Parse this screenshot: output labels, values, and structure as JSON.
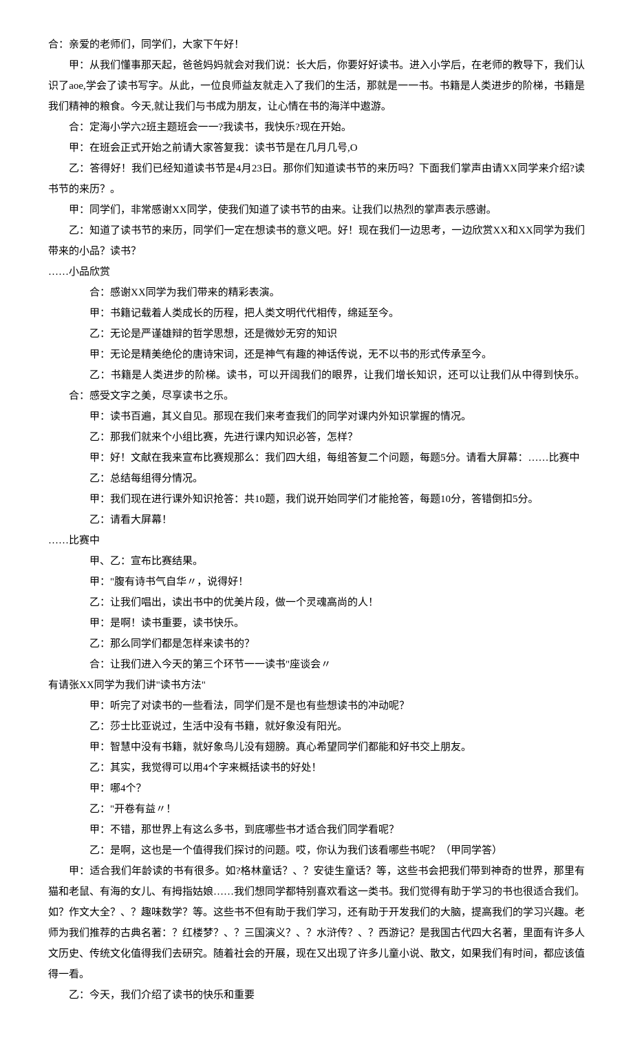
{
  "p": [
    "合：亲爱的老师们，同学们，大家下午好！",
    "甲：从我们懂事那天起，爸爸妈妈就会对我们说：长大后，你要好好读书。进入小学后，在老师的教导下，我们认识了aoe,学会了读书写字。从此，一位良师益友就走入了我们的生活，那就是一一书。书籍是人类进步的阶梯，书籍是我们精神的粮食。今天,就让我们与书成为朋友，让心情在书的海洋中遨游。",
    "合：定海小学六2班主题班会一一?我读书，我快乐?现在开始。",
    "甲：在班会正式开始之前请大家答复我：读书节是在几月几号,O",
    "乙：答得好！我们已经知道读书节是4月23日。那你们知道读书节的来历吗？下面我们掌声由请XX同学来介绍?读书节的来历？。",
    "甲：同学们，非常感谢XX同学，使我们知道了读书节的由来。让我们以热烈的掌声表示感谢。",
    "乙：知道了读书节的来历，同学们一定在想读书的意义吧。好！现在我们一边思考，一边欣赏XX和XX同学为我们带来的小品？读书？",
    "……小品欣赏",
    "合：感谢XX同学为我们带来的精彩表演。",
    "甲：书籍记载着人类成长的历程，把人类文明代代相传，绵延至今。",
    "乙：无论是严谨雄辩的哲学思想，还是微妙无穷的知识",
    "甲：无论是精美绝伦的唐诗宋词，还是神气有趣的神话传说，无不以书的形式传承至今。",
    "乙：书籍是人类进步的阶梯。读书，可以开阔我们的眼界，让我们增长知识，还可以让我们从中得到快乐。合：感受文字之美，尽享读书之乐。",
    "甲：读书百遍，其义自见。那现在我们来考查我们的同学对课内外知识掌握的情况。",
    "乙：那我们就来个小组比赛，先进行课内知识必答，怎样？",
    "甲：好！文献在我来宣布比赛规那么：我们四大组，每组答复二个问题，每题5分。请看大屏幕：……比赛中",
    "乙：总结每组得分情况。",
    "甲：我们现在进行课外知识抢答：共10题，我们说开始同学们才能抢答，每题10分，答错倒扣5分。",
    "乙：请看大屏幕！",
    "……比赛中",
    "甲、乙：宣布比赛结果。",
    "甲：\"腹有诗书气自华〃，说得好！",
    "乙：让我们唱出，读出书中的优美片段，做一个灵魂高尚的人！",
    "甲：是啊！读书重要，读书快乐。",
    "乙：那么同学们都是怎样来读书的？",
    "合：让我们进入今天的第三个环节一一读书\"座谈会〃",
    "有请张XX同学为我们讲\"读书方法\"",
    "甲：听完了对读书的一些看法，同学们是不是也有些想读书的冲动呢？",
    "乙：莎士比亚说过，生活中没有书籍，就好象没有阳光。",
    "甲：智慧中没有书籍，就好象鸟儿没有翅膀。真心希望同学们都能和好书交上朋友。",
    "乙：其实，我觉得可以用4个字来概括读书的好处！",
    "甲：哪4个？",
    "乙：\"开卷有益〃！",
    "甲：不错，那世界上有这么多书，到底哪些书才适合我们同学看呢？",
    "乙：是啊，这也是一个值得我们探讨的问题。哎，你认为我们该看哪些书呢？（甲同学答）",
    "甲：适合我们年龄读的书有很多。如?格林童话？、？安徒生童话？等，这些书会把我们带到神奇的世界，那里有猫和老鼠、有海的女儿、有拇指姑娘……我们想同学都特别喜欢看这一类书。我们觉得有助于学习的书也很适合我们。如？作文大全？、？趣味数学？等。这些书不但有助于我们学习，还有助于开发我们的大脑，提高我们的学习兴趣。老师为我们推荐的古典名著：？红楼梦？、？三国演义？、？水浒传？、？西游记？是我国古代四大名著，里面有许多人文历史、传统文化值得我们去研究。随着社会的开展，现在又出现了许多儿童小说、散文，如果我们有时间，都应该值得一看。",
    "乙：今天，我们介绍了读书的快乐和重要"
  ],
  "style": [
    {
      "indent": "indent0"
    },
    {
      "indent": "indent1"
    },
    {
      "indent": "indent1"
    },
    {
      "indent": "indent1"
    },
    {
      "indent": "indent1"
    },
    {
      "indent": "indent1"
    },
    {
      "indent": "indent1"
    },
    {
      "indent": "indent0"
    },
    {
      "indent": "indent1",
      "block": true
    },
    {
      "indent": "indent1",
      "block": true
    },
    {
      "indent": "indent1",
      "block": true
    },
    {
      "indent": "indent1",
      "block": true
    },
    {
      "indent": "indent1",
      "block": true
    },
    {
      "indent": "indent1",
      "block": true
    },
    {
      "indent": "indent1",
      "block": true
    },
    {
      "indent": "indent1",
      "block": true
    },
    {
      "indent": "indent1",
      "block": true
    },
    {
      "indent": "indent1",
      "block": true
    },
    {
      "indent": "indent1",
      "block": true
    },
    {
      "indent": "indent0"
    },
    {
      "indent": "indent1",
      "block": true
    },
    {
      "indent": "indent1",
      "block": true
    },
    {
      "indent": "indent1",
      "block": true
    },
    {
      "indent": "indent1",
      "block": true
    },
    {
      "indent": "indent1",
      "block": true
    },
    {
      "indent": "indent1",
      "block": true
    },
    {
      "indent": "indent0"
    },
    {
      "indent": "indent1",
      "block": true
    },
    {
      "indent": "indent1",
      "block": true
    },
    {
      "indent": "indent1",
      "block": true
    },
    {
      "indent": "indent1",
      "block": true
    },
    {
      "indent": "indent1",
      "block": true
    },
    {
      "indent": "indent1",
      "block": true
    },
    {
      "indent": "indent1",
      "block": true
    },
    {
      "indent": "indent1",
      "block": true
    },
    {
      "indent": "indent1"
    },
    {
      "indent": "indent1"
    }
  ]
}
